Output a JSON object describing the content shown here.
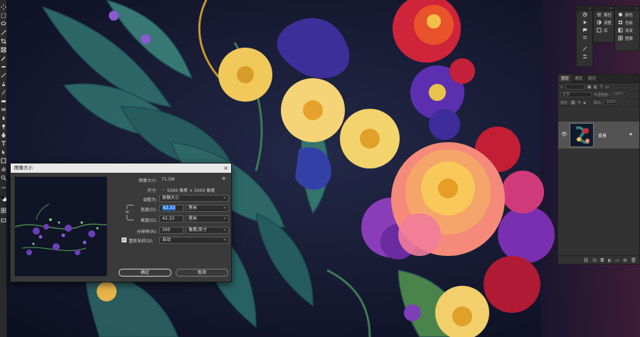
{
  "dialog": {
    "title": "图像大小",
    "image_size_label": "图像大小:",
    "image_size_value": "71.5M",
    "dimensions_label": "尺寸:",
    "dimensions_value": "5000 像素 × 5000 像素",
    "fit_to_label": "调整为:",
    "fit_to_value": "原稿大小",
    "width_label": "宽度(D):",
    "width_value": "42.33",
    "width_unit": "厘米",
    "height_label": "高度(G):",
    "height_value": "42.33",
    "height_unit": "厘米",
    "resolution_label": "分辨率(R):",
    "resolution_value": "300",
    "resolution_unit": "像素/英寸",
    "resample_label": "重新采样(S):",
    "resample_checked": true,
    "resample_value": "自动",
    "ok_label": "确定",
    "cancel_label": "取消"
  },
  "panels": {
    "properties_label": "属性",
    "adjustments_label": "调整",
    "library_label": "库",
    "color_label": "颜色",
    "swatches_label": "色板",
    "gradient_label": "渐变",
    "pattern_label": "图案"
  },
  "layers_panel": {
    "tabs": [
      "图层",
      "通道",
      "路径"
    ],
    "blend_mode": "正常",
    "opacity_label": "不透明度:",
    "opacity_value": "100%",
    "fill_label": "填充:",
    "fill_value": "100%",
    "lock_label": "锁定:",
    "layer_name": "背景"
  },
  "colors": {
    "dialog_bg": "#3a3a3a",
    "panel_bg": "#323232",
    "selection": "#1f6fd1"
  }
}
